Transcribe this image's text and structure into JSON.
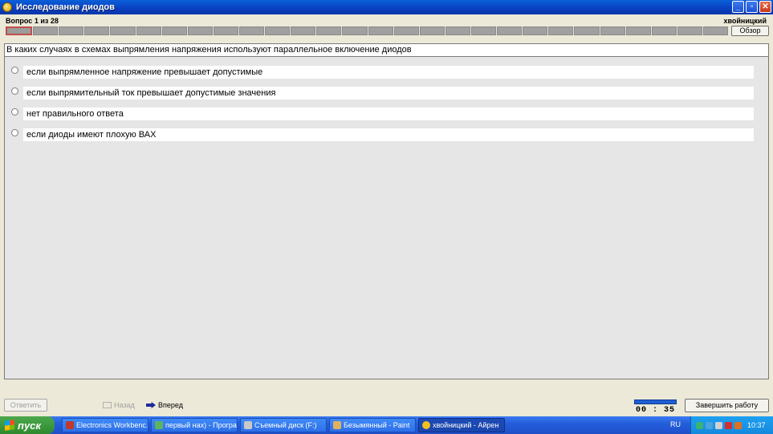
{
  "window": {
    "title": "Исследование диодов",
    "buttons": [
      "minimize",
      "maximize",
      "close"
    ]
  },
  "header": {
    "question_counter": "Вопрос 1 из 28",
    "user_name": "хвойницкий",
    "overview_label": "Обзор",
    "total_questions": 28,
    "current_question": 1
  },
  "question": {
    "text": "В каких случаях в схемах выпрямления напряжения используют параллельное включение диодов",
    "answers": [
      "если выпрямленное напряжение превышает допустимые",
      "если выпрямительный ток превышает допустимые значения",
      "нет правильного ответа",
      "если диоды имеют плохую ВАХ"
    ]
  },
  "footer": {
    "answer_label": "Ответить",
    "back_label": "Назад",
    "forward_label": "Вперед",
    "timer": "00 : 35",
    "finish_label": "Завершить работу"
  },
  "taskbar": {
    "start_label": "пуск",
    "tasks": [
      "Electronics Workbenc...",
      "первый нах) - Програ...",
      "Съемный диск (F:)",
      "Безымянный - Paint",
      "хвойницкий - Айрен"
    ],
    "language": "RU",
    "clock": "10:37"
  },
  "colors": {
    "titlebar": "#0a4fd0",
    "current_question_border": "#c0504d",
    "timer_bar": "#1f5fd0",
    "start_button": "#2f8a2f"
  }
}
